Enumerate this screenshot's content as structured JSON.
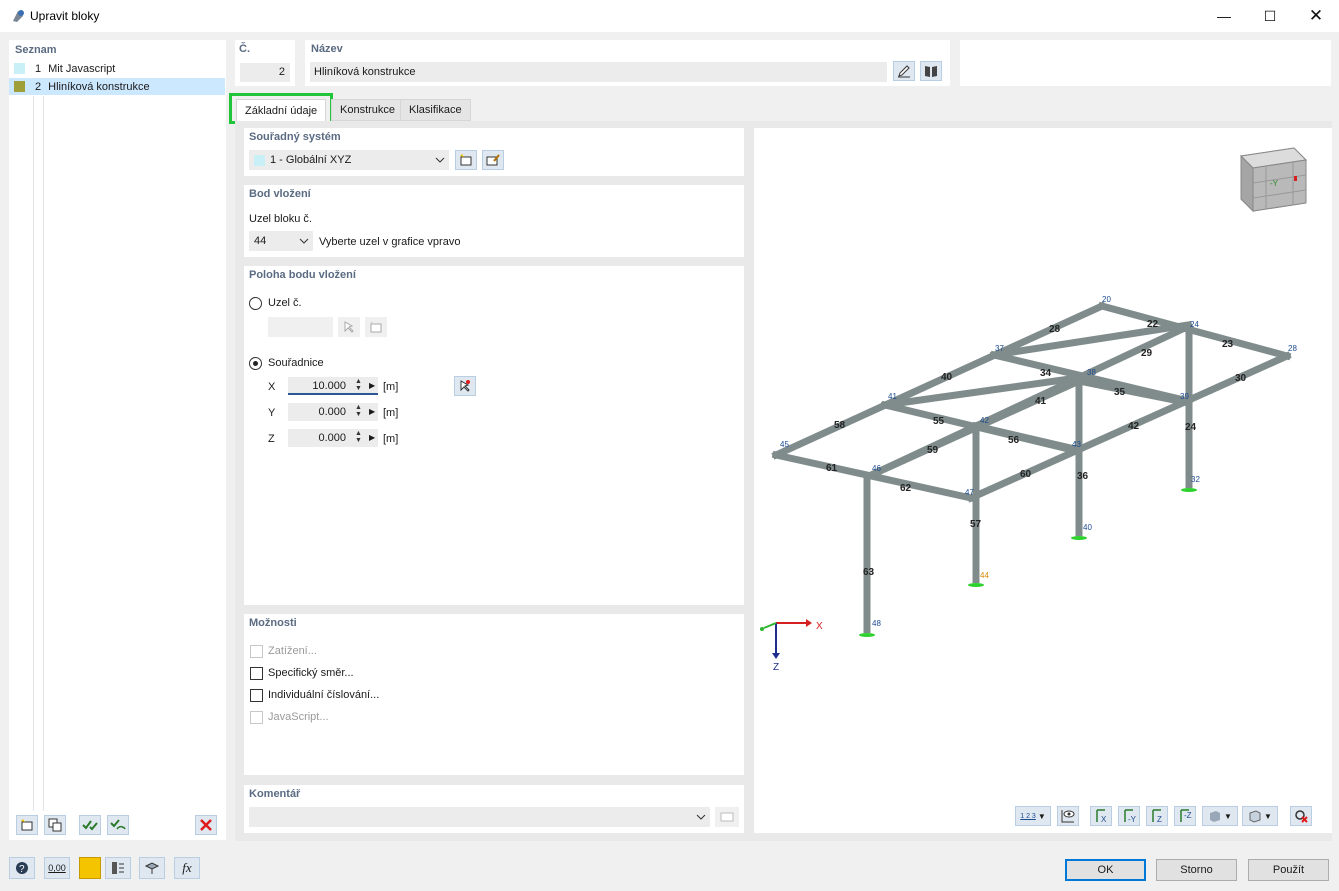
{
  "window": {
    "title": "Upravit bloky"
  },
  "list": {
    "header": "Seznam",
    "items": [
      {
        "no": "1",
        "name": "Mit Javascript",
        "color": "#c9f0f7"
      },
      {
        "no": "2",
        "name": "Hliníková konstrukce",
        "color": "#9f9f3a"
      }
    ]
  },
  "number": {
    "label": "Č.",
    "value": "2"
  },
  "name": {
    "label": "Název",
    "value": "Hliníková konstrukce"
  },
  "tabs": [
    "Základní údaje",
    "Konstrukce",
    "Klasifikace"
  ],
  "coord_system": {
    "title": "Souřadný systém",
    "value": "1 - Globální XYZ",
    "swatch": "#c9f0f7"
  },
  "insert_point": {
    "title": "Bod vložení",
    "node_label": "Uzel bloku č.",
    "node_value": "44",
    "hint": "Vyberte uzel v grafice vpravo"
  },
  "position": {
    "title": "Poloha bodu vložení",
    "radio_node": "Uzel č.",
    "radio_coords": "Souřadnice",
    "coords": [
      {
        "axis": "X",
        "value": "10.000",
        "unit": "[m]"
      },
      {
        "axis": "Y",
        "value": "0.000",
        "unit": "[m]"
      },
      {
        "axis": "Z",
        "value": "0.000",
        "unit": "[m]"
      }
    ]
  },
  "options": {
    "title": "Možnosti",
    "items": [
      {
        "label": "Zatížení...",
        "enabled": false,
        "checked": false
      },
      {
        "label": "Specifický směr...",
        "enabled": true,
        "checked": false
      },
      {
        "label": "Individuální číslování...",
        "enabled": true,
        "checked": false
      },
      {
        "label": "JavaScript...",
        "enabled": false,
        "checked": false
      }
    ]
  },
  "comment": {
    "title": "Komentář",
    "value": ""
  },
  "viewport": {
    "axis_x": "X",
    "axis_z": "Z",
    "cube_face": "-Y",
    "node_labels": [
      "20",
      "24",
      "28",
      "37",
      "38",
      "39",
      "41",
      "42",
      "43",
      "45",
      "46",
      "47",
      "32",
      "40",
      "44",
      "48"
    ],
    "member_labels": [
      "28",
      "22",
      "23",
      "29",
      "40",
      "34",
      "35",
      "30",
      "41",
      "24",
      "58",
      "55",
      "56",
      "42",
      "59",
      "36",
      "61",
      "60",
      "62",
      "57",
      "63"
    ],
    "toolbar_text": "1 2 3"
  },
  "buttons": {
    "ok": "OK",
    "cancel": "Storno",
    "apply": "Použít"
  },
  "bottom_icons": {
    "value_label": "0,00",
    "fx_label": "fx"
  },
  "colors": {
    "accent_highlight": "#22c43a",
    "selection": "#cce8ff",
    "beam": "#8a9594",
    "node_blue": "#1d4b8f",
    "support": "#2fd12f"
  }
}
